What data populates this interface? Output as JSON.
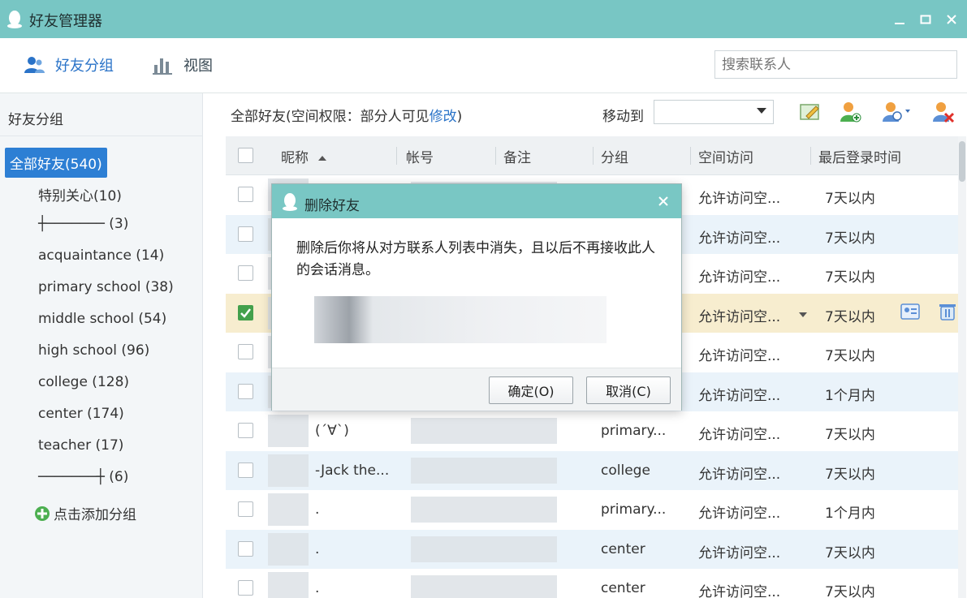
{
  "window": {
    "title": "好友管理器",
    "controls": [
      "minimize",
      "maximize",
      "close"
    ]
  },
  "toolbar": {
    "group_tab": "好友分组",
    "view_tab": "视图",
    "search_placeholder": "搜索联系人"
  },
  "sidebar": {
    "header": "好友分组",
    "groups": [
      "全部好友(540)",
      "特别关心(10)",
      "┼─────── (3)",
      "acquaintance (14)",
      "primary school (38)",
      "middle school (54)",
      "high school (96)",
      "college (128)",
      "center (174)",
      "teacher (17)",
      "───────┼ (6)"
    ],
    "add_group": "点击添加分组"
  },
  "main": {
    "permission_prefix": "全部好友(空间权限：部分人可见",
    "permission_link": "修改",
    "permission_suffix": ")",
    "move_to_label": "移动到",
    "move_to_value": ""
  },
  "table": {
    "headers": [
      "昵称",
      "帐号",
      "备注",
      "分组",
      "空间访问",
      "最后登录时间"
    ],
    "rows": [
      {
        "nickname": "",
        "group": "",
        "access": "允许访问空...",
        "last_login": "7天以内",
        "checked": false
      },
      {
        "nickname": "",
        "group": "",
        "access": "允许访问空...",
        "last_login": "7天以内",
        "checked": false
      },
      {
        "nickname": "",
        "group": "",
        "access": "允许访问空...",
        "last_login": "7天以内",
        "checked": false
      },
      {
        "nickname": "",
        "group": "",
        "access": "允许访问空...",
        "last_login": "7天以内",
        "checked": true
      },
      {
        "nickname": "",
        "group": "",
        "access": "允许访问空...",
        "last_login": "7天以内",
        "checked": false
      },
      {
        "nickname": "",
        "group": "",
        "access": "允许访问空...",
        "last_login": "1个月内",
        "checked": false
      },
      {
        "nickname": "(´∀`)",
        "group": "primary...",
        "access": "允许访问空...",
        "last_login": "7天以内",
        "checked": false
      },
      {
        "nickname": "-Jack the...",
        "group": "college",
        "access": "允许访问空...",
        "last_login": "7天以内",
        "checked": false
      },
      {
        "nickname": ".",
        "group": "primary...",
        "access": "允许访问空...",
        "last_login": "1个月内",
        "checked": false
      },
      {
        "nickname": ".",
        "group": "center",
        "access": "允许访问空...",
        "last_login": "7天以内",
        "checked": false
      },
      {
        "nickname": ".",
        "group": "center",
        "access": "允许访问空...",
        "last_login": "7天以内",
        "checked": false
      }
    ]
  },
  "dialog": {
    "title": "删除好友",
    "message": "删除后你将从对方联系人列表中消失，且以后不再接收此人的会话消息。",
    "confirm_label": "确定(O)",
    "cancel_label": "取消(C)"
  },
  "colors": {
    "titlebar": "#78c6c4",
    "accent": "#2d7fd4",
    "selected_row": "#f7edcf",
    "alt_row": "#eaf3fa"
  },
  "icons": [
    "qq-penguin-icon",
    "friends-group-icon",
    "bar-chart-icon",
    "edit-note-icon",
    "add-friend-icon",
    "manage-friend-icon",
    "delete-friend-icon",
    "contact-card-icon",
    "trash-icon"
  ]
}
